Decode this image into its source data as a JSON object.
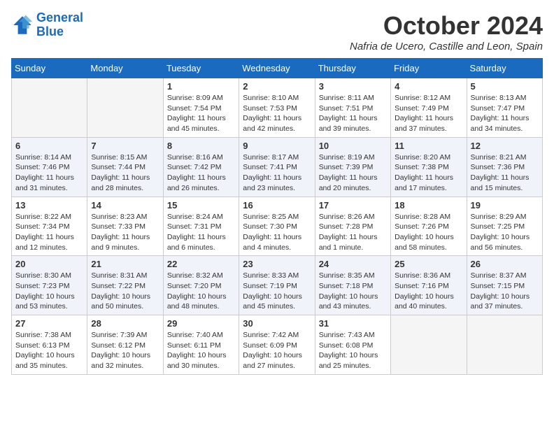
{
  "header": {
    "logo_line1": "General",
    "logo_line2": "Blue",
    "month": "October 2024",
    "subtitle": "Nafria de Ucero, Castille and Leon, Spain"
  },
  "weekdays": [
    "Sunday",
    "Monday",
    "Tuesday",
    "Wednesday",
    "Thursday",
    "Friday",
    "Saturday"
  ],
  "weeks": [
    [
      {
        "day": "",
        "info": ""
      },
      {
        "day": "",
        "info": ""
      },
      {
        "day": "1",
        "info": "Sunrise: 8:09 AM\nSunset: 7:54 PM\nDaylight: 11 hours and 45 minutes."
      },
      {
        "day": "2",
        "info": "Sunrise: 8:10 AM\nSunset: 7:53 PM\nDaylight: 11 hours and 42 minutes."
      },
      {
        "day": "3",
        "info": "Sunrise: 8:11 AM\nSunset: 7:51 PM\nDaylight: 11 hours and 39 minutes."
      },
      {
        "day": "4",
        "info": "Sunrise: 8:12 AM\nSunset: 7:49 PM\nDaylight: 11 hours and 37 minutes."
      },
      {
        "day": "5",
        "info": "Sunrise: 8:13 AM\nSunset: 7:47 PM\nDaylight: 11 hours and 34 minutes."
      }
    ],
    [
      {
        "day": "6",
        "info": "Sunrise: 8:14 AM\nSunset: 7:46 PM\nDaylight: 11 hours and 31 minutes."
      },
      {
        "day": "7",
        "info": "Sunrise: 8:15 AM\nSunset: 7:44 PM\nDaylight: 11 hours and 28 minutes."
      },
      {
        "day": "8",
        "info": "Sunrise: 8:16 AM\nSunset: 7:42 PM\nDaylight: 11 hours and 26 minutes."
      },
      {
        "day": "9",
        "info": "Sunrise: 8:17 AM\nSunset: 7:41 PM\nDaylight: 11 hours and 23 minutes."
      },
      {
        "day": "10",
        "info": "Sunrise: 8:19 AM\nSunset: 7:39 PM\nDaylight: 11 hours and 20 minutes."
      },
      {
        "day": "11",
        "info": "Sunrise: 8:20 AM\nSunset: 7:38 PM\nDaylight: 11 hours and 17 minutes."
      },
      {
        "day": "12",
        "info": "Sunrise: 8:21 AM\nSunset: 7:36 PM\nDaylight: 11 hours and 15 minutes."
      }
    ],
    [
      {
        "day": "13",
        "info": "Sunrise: 8:22 AM\nSunset: 7:34 PM\nDaylight: 11 hours and 12 minutes."
      },
      {
        "day": "14",
        "info": "Sunrise: 8:23 AM\nSunset: 7:33 PM\nDaylight: 11 hours and 9 minutes."
      },
      {
        "day": "15",
        "info": "Sunrise: 8:24 AM\nSunset: 7:31 PM\nDaylight: 11 hours and 6 minutes."
      },
      {
        "day": "16",
        "info": "Sunrise: 8:25 AM\nSunset: 7:30 PM\nDaylight: 11 hours and 4 minutes."
      },
      {
        "day": "17",
        "info": "Sunrise: 8:26 AM\nSunset: 7:28 PM\nDaylight: 11 hours and 1 minute."
      },
      {
        "day": "18",
        "info": "Sunrise: 8:28 AM\nSunset: 7:26 PM\nDaylight: 10 hours and 58 minutes."
      },
      {
        "day": "19",
        "info": "Sunrise: 8:29 AM\nSunset: 7:25 PM\nDaylight: 10 hours and 56 minutes."
      }
    ],
    [
      {
        "day": "20",
        "info": "Sunrise: 8:30 AM\nSunset: 7:23 PM\nDaylight: 10 hours and 53 minutes."
      },
      {
        "day": "21",
        "info": "Sunrise: 8:31 AM\nSunset: 7:22 PM\nDaylight: 10 hours and 50 minutes."
      },
      {
        "day": "22",
        "info": "Sunrise: 8:32 AM\nSunset: 7:20 PM\nDaylight: 10 hours and 48 minutes."
      },
      {
        "day": "23",
        "info": "Sunrise: 8:33 AM\nSunset: 7:19 PM\nDaylight: 10 hours and 45 minutes."
      },
      {
        "day": "24",
        "info": "Sunrise: 8:35 AM\nSunset: 7:18 PM\nDaylight: 10 hours and 43 minutes."
      },
      {
        "day": "25",
        "info": "Sunrise: 8:36 AM\nSunset: 7:16 PM\nDaylight: 10 hours and 40 minutes."
      },
      {
        "day": "26",
        "info": "Sunrise: 8:37 AM\nSunset: 7:15 PM\nDaylight: 10 hours and 37 minutes."
      }
    ],
    [
      {
        "day": "27",
        "info": "Sunrise: 7:38 AM\nSunset: 6:13 PM\nDaylight: 10 hours and 35 minutes."
      },
      {
        "day": "28",
        "info": "Sunrise: 7:39 AM\nSunset: 6:12 PM\nDaylight: 10 hours and 32 minutes."
      },
      {
        "day": "29",
        "info": "Sunrise: 7:40 AM\nSunset: 6:11 PM\nDaylight: 10 hours and 30 minutes."
      },
      {
        "day": "30",
        "info": "Sunrise: 7:42 AM\nSunset: 6:09 PM\nDaylight: 10 hours and 27 minutes."
      },
      {
        "day": "31",
        "info": "Sunrise: 7:43 AM\nSunset: 6:08 PM\nDaylight: 10 hours and 25 minutes."
      },
      {
        "day": "",
        "info": ""
      },
      {
        "day": "",
        "info": ""
      }
    ]
  ]
}
